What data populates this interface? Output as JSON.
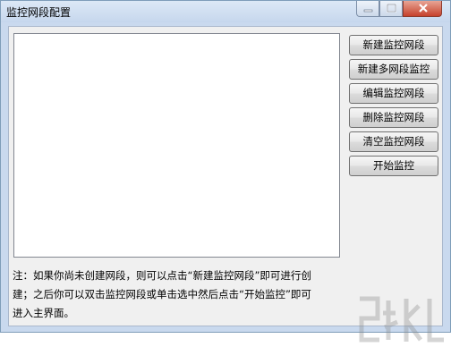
{
  "window": {
    "title": "监控网段配置"
  },
  "buttons": {
    "new_segment": "新建监控网段",
    "new_multi_segment": "新建多网段监控",
    "edit_segment": "编辑监控网段",
    "delete_segment": "删除监控网段",
    "clear_segment": "清空监控网段",
    "start_monitor": "开始监控"
  },
  "note": {
    "line1": "注：如果你尚未创建网段，则可以点击“新建监控网段”即可进行创",
    "line2": "建；之后你可以双击监控网段或单击选中然后点击“开始监控”即可",
    "line3": "进入主界面。"
  },
  "list": {
    "items": []
  }
}
